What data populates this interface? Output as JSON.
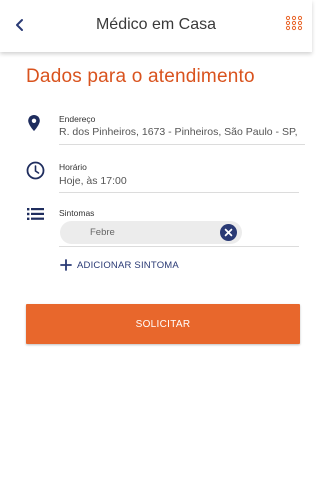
{
  "header": {
    "title": "Médico em Casa",
    "back_icon": "chevron-left-icon",
    "menu_icon": "grid-icon"
  },
  "page": {
    "heading": "Dados para o atendimento"
  },
  "fields": {
    "address": {
      "label": "Endereço",
      "value": "R. dos Pinheiros, 1673 - Pinheiros, São Paulo - SP,",
      "icon": "location-pin-icon"
    },
    "time": {
      "label": "Horário",
      "value": "Hoje, às 17:00",
      "icon": "clock-icon"
    },
    "symptoms": {
      "label": "Sintomas",
      "icon": "list-icon",
      "items": [
        {
          "label": "Febre",
          "remove_icon": "close-circle-icon"
        }
      ]
    }
  },
  "add_symptom": {
    "label": "ADICIONAR SINTOMA",
    "icon": "plus-icon"
  },
  "submit": {
    "label": "SOLICITAR"
  },
  "colors": {
    "accent": "#e8672c",
    "heading": "#d9531e",
    "navy": "#2a3a75"
  }
}
